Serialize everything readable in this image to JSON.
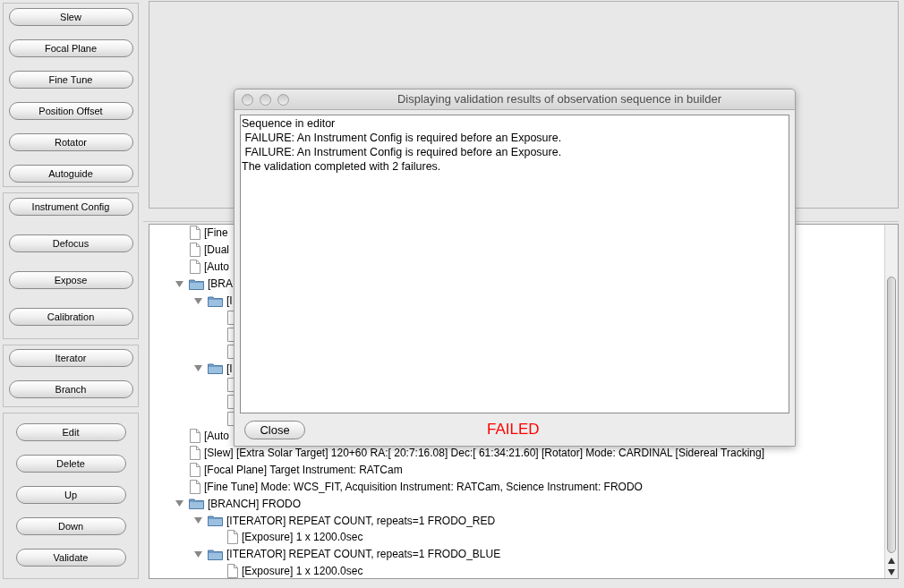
{
  "button_groups": [
    {
      "buttons": [
        "Slew",
        "Focal Plane",
        "Fine Tune",
        "Position Offset",
        "Rotator",
        "Autoguide"
      ]
    },
    {
      "buttons": [
        "Instrument Config",
        "Defocus",
        "Expose",
        "Calibration"
      ]
    },
    {
      "buttons": [
        "Iterator",
        "Branch"
      ]
    },
    {
      "buttons": [
        "Edit",
        "Delete",
        "Up",
        "Down",
        "Validate"
      ]
    }
  ],
  "tree": [
    {
      "kind": "file",
      "label": "[Fine"
    },
    {
      "kind": "file",
      "label": "[Dual"
    },
    {
      "kind": "file",
      "label": "[Auto"
    },
    {
      "kind": "folder",
      "label": "[BRA",
      "expanded": true,
      "children": [
        {
          "kind": "folder",
          "label": "[I",
          "expanded": true,
          "children": [
            {
              "kind": "file"
            },
            {
              "kind": "file"
            },
            {
              "kind": "file"
            }
          ]
        },
        {
          "kind": "folder",
          "label": "[I",
          "expanded": true,
          "children": [
            {
              "kind": "file"
            },
            {
              "kind": "file"
            },
            {
              "kind": "file"
            }
          ]
        }
      ]
    },
    {
      "kind": "file",
      "label": "[Auto"
    },
    {
      "kind": "file",
      "label": "[Slew] [Extra Solar Target] 120+60 RA:[ 20:7:16.08] Dec:[ 61:34:21.60] [Rotator] Mode: CARDINAL [Sidereal Tracking]"
    },
    {
      "kind": "file",
      "label": "[Focal Plane] Target Instrument: RATCam"
    },
    {
      "kind": "file",
      "label": "[Fine Tune] Mode: WCS_FIT, Acquisition Instrument: RATCam, Science Instrument: FRODO"
    },
    {
      "kind": "folder",
      "label": "[BRANCH] FRODO",
      "expanded": true,
      "children": [
        {
          "kind": "folder",
          "label": "[ITERATOR] REPEAT COUNT, repeats=1 FRODO_RED",
          "expanded": true,
          "children": [
            {
              "kind": "file",
              "label": "[Exposure] 1 x 1200.0sec"
            }
          ]
        },
        {
          "kind": "folder",
          "label": "[ITERATOR] REPEAT COUNT, repeats=1 FRODO_BLUE",
          "expanded": true,
          "children": [
            {
              "kind": "file",
              "label": "[Exposure] 1 x 1200.0sec"
            }
          ]
        }
      ]
    }
  ],
  "dialog": {
    "title": "Displaying validation results of observation sequence in builder",
    "lines": [
      "Sequence in editor",
      " FAILURE: An Instrument Config is required before an Exposure.",
      " FAILURE: An Instrument Config is required before an Exposure.",
      "The validation completed with 2 failures."
    ],
    "close_button": "Close",
    "status": "FAILED"
  }
}
